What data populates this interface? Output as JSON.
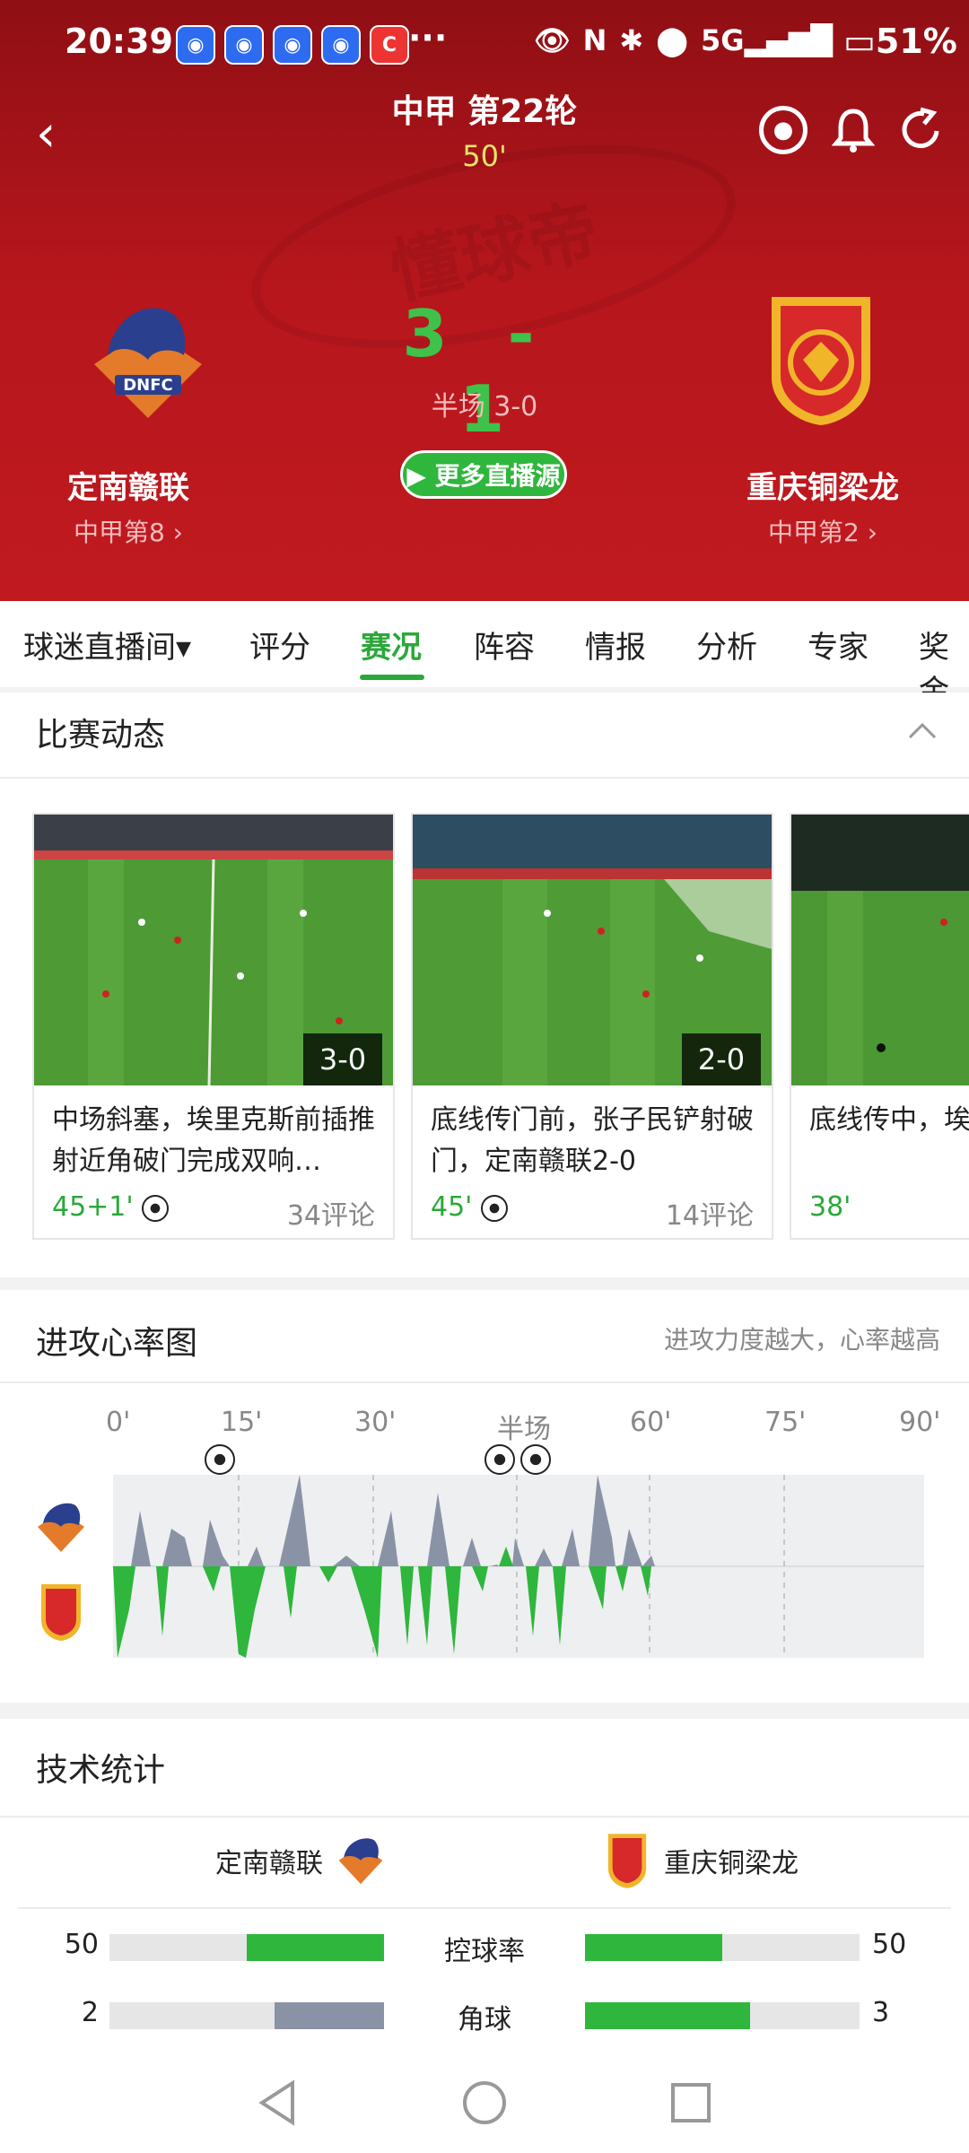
{
  "status_bar": {
    "time": "20:39",
    "dots": "···",
    "network": "5G",
    "battery": "51%"
  },
  "header": {
    "title": "中甲 第22轮",
    "minute": "50'",
    "watermark": "懂球帝",
    "home": {
      "name": "定南赣联",
      "rank": "中甲第8",
      "logo_text": "DNFC",
      "score": "3"
    },
    "away": {
      "name": "重庆铜梁龙",
      "rank": "中甲第2",
      "score": "1"
    },
    "score_sep": "-",
    "halftime": "半场 3-0",
    "live_button": "▶ 更多直播源"
  },
  "tabs": [
    {
      "label": "球迷直播间▾"
    },
    {
      "label": "评分"
    },
    {
      "label": "赛况",
      "active": true
    },
    {
      "label": "阵容"
    },
    {
      "label": "情报"
    },
    {
      "label": "分析"
    },
    {
      "label": "专家"
    },
    {
      "label": "奖金"
    }
  ],
  "match_events": {
    "title": "比赛动态",
    "cards": [
      {
        "score": "3-0",
        "text": "中场斜塞，埃里克斯前插推射近角破门完成双响…",
        "minute": "45+1'",
        "comments": "34评论"
      },
      {
        "score": "2-0",
        "text": "底线传门前，张子民铲射破门，定南赣联2-0",
        "minute": "45'",
        "comments": "14评论"
      },
      {
        "score": "",
        "text": "底线传中，埃尔南德斯咫尺的头球攻门",
        "minute": "38'",
        "comments": ""
      }
    ]
  },
  "heart_rate": {
    "title": "进攻心率图",
    "subtitle": "进攻力度越大，心率越高",
    "axis": [
      "0'",
      "15'",
      "30'",
      "半场",
      "60'",
      "75'",
      "90'"
    ]
  },
  "tech_stats": {
    "title": "技术统计",
    "home_name": "定南赣联",
    "away_name": "重庆铜梁龙",
    "rows": [
      {
        "label": "控球率",
        "home": "50",
        "away": "50",
        "home_frac": 0.5,
        "away_frac": 0.5,
        "home_color": "#2fb63d",
        "away_color": "#2fb63d"
      },
      {
        "label": "角球",
        "home": "2",
        "away": "3",
        "home_frac": 0.4,
        "away_frac": 0.6,
        "home_color": "#8a93a6",
        "away_color": "#2fb63d"
      }
    ]
  },
  "colors": {
    "accent": "#2ba83a",
    "header_red": "#b5161c",
    "away_bar": "#2fb63d",
    "home_bar": "#8a93a6"
  }
}
